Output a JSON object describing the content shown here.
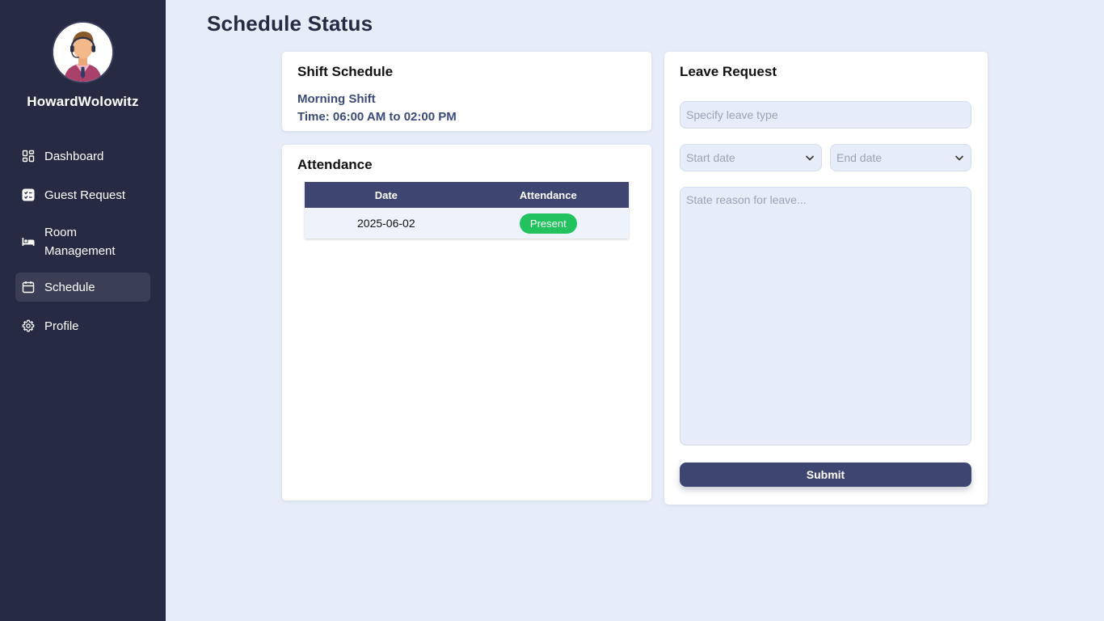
{
  "user": {
    "name": "HowardWolowitz"
  },
  "sidebar": {
    "items": [
      {
        "label": "Dashboard",
        "icon": "dashboard-icon",
        "active": false
      },
      {
        "label": "Guest Request",
        "icon": "checklist-icon",
        "active": false
      },
      {
        "label": "Room Management",
        "icon": "bed-icon",
        "active": false
      },
      {
        "label": "Schedule",
        "icon": "calendar-icon",
        "active": true
      },
      {
        "label": "Profile",
        "icon": "gear-icon",
        "active": false
      }
    ]
  },
  "page": {
    "title": "Schedule Status"
  },
  "shift": {
    "title": "Shift Schedule",
    "name": "Morning Shift",
    "time": "Time: 06:00 AM to 02:00 PM"
  },
  "attendance": {
    "title": "Attendance",
    "columns": [
      "Date",
      "Attendance"
    ],
    "rows": [
      {
        "date": "2025-06-02",
        "status": "Present"
      }
    ]
  },
  "leave": {
    "title": "Leave Request",
    "type_placeholder": "Specify leave type",
    "start_placeholder": "Start date",
    "end_placeholder": "End date",
    "reason_placeholder": "State reason for leave...",
    "submit_label": "Submit"
  },
  "colors": {
    "sidebar_bg": "#262a42",
    "accent": "#3d4570",
    "page_bg": "#e6edf8",
    "present": "#22c35e"
  }
}
